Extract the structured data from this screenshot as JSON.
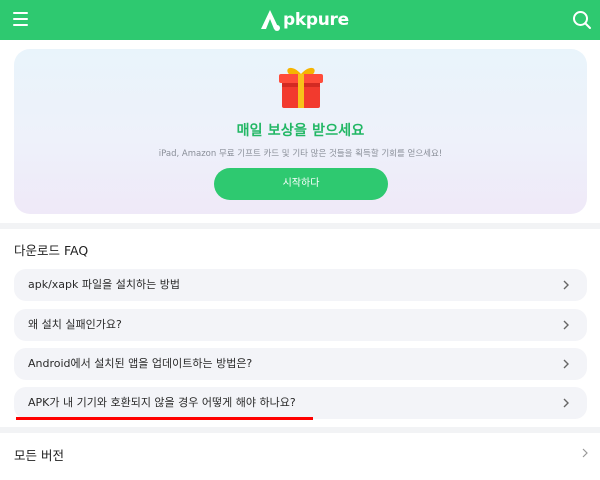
{
  "header": {
    "logo_text": "pkpure",
    "icons": {
      "menu": "hamburger-menu-icon",
      "search": "search-icon",
      "logo": "apkpure-logo-mark"
    },
    "brand_color": "#2ec970"
  },
  "reward": {
    "icon": "gift-box-icon",
    "title": "매일 보상을 받으세요",
    "subtitle": "iPad, Amazon 무료 기프트 카드 및 기타 많은 것들을 획득할 기회를 얻으세요!",
    "cta_label": "시작하다"
  },
  "faq": {
    "heading": "다운로드 FAQ",
    "items": [
      {
        "question": "apk/xapk 파일을 설치하는 방법"
      },
      {
        "question": "왜 설치 실패인가요?"
      },
      {
        "question": "Android에서 설치된 앱을 업데이트하는 방법은?"
      },
      {
        "question": "APK가 내 기기와 호환되지 않을 경우 어떻게 해야 하나요?"
      }
    ],
    "highlight_color": "#ff0000"
  },
  "versions": {
    "label": "모든 버전"
  }
}
